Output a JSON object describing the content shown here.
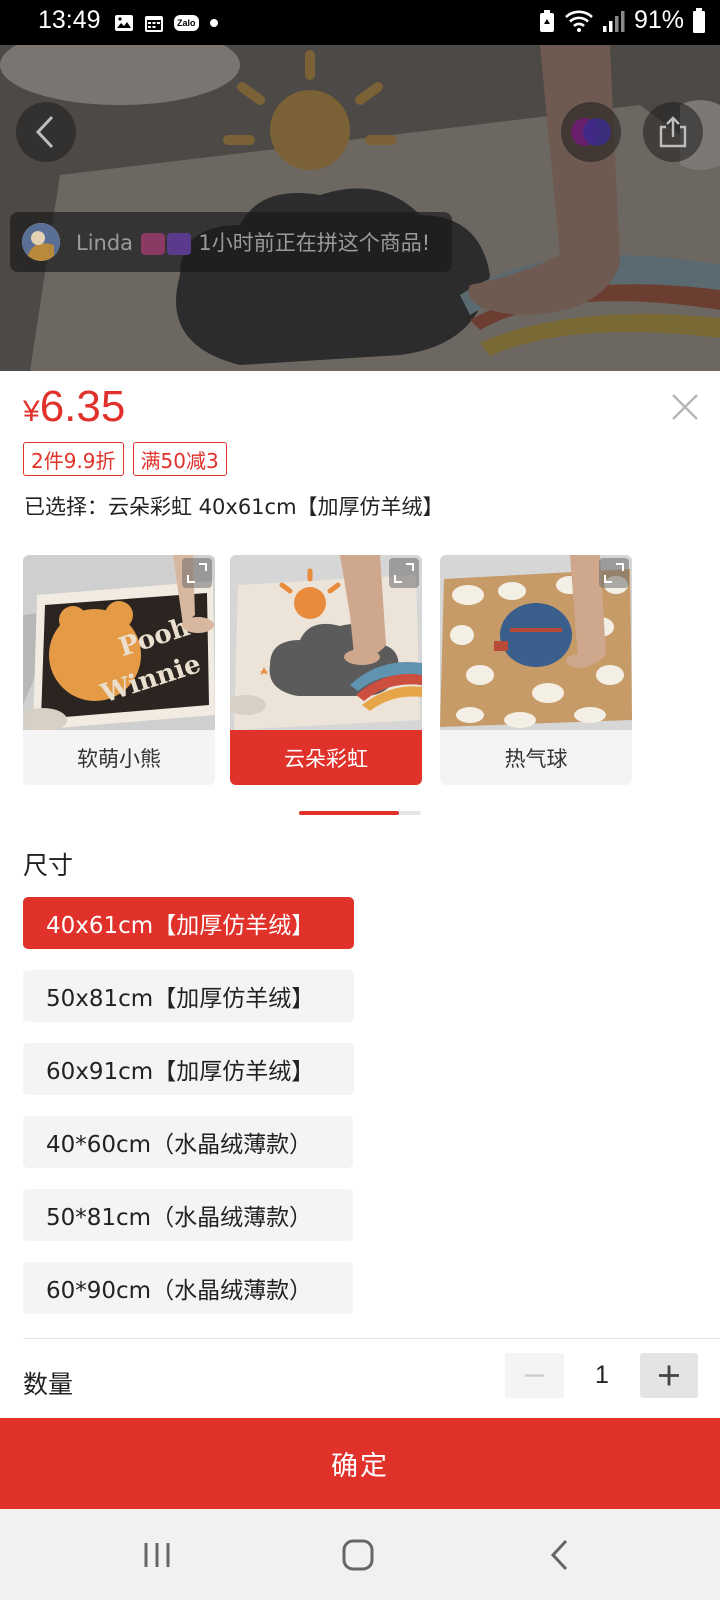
{
  "status_bar": {
    "time": "13:49",
    "battery": "91%",
    "left_icons": [
      "image-icon",
      "calendar-icon",
      "zalo-icon",
      "dot-icon"
    ],
    "zalo_text": "Zalo",
    "right_icons": [
      "recycle-icon",
      "wifi-icon",
      "signal-icon",
      "battery-icon"
    ]
  },
  "header": {
    "back_icon": "chevron-left-icon",
    "share_icon": "share-icon",
    "buyer_toast": {
      "name": "Linda",
      "suffix": "1小时前正在拼这个商品!"
    }
  },
  "product": {
    "currency": "¥",
    "price": "6.35",
    "promos": [
      "2件9.9折",
      "满50减3"
    ],
    "selected_label": "已选择：",
    "selected_value": "云朵彩虹 40x61cm【加厚仿羊绒】"
  },
  "styles": [
    {
      "label": "软萌小熊",
      "active": false
    },
    {
      "label": "云朵彩虹",
      "active": true
    },
    {
      "label": "热气球",
      "active": false
    }
  ],
  "size_section": {
    "title": "尺寸",
    "options": [
      {
        "label": "40x61cm【加厚仿羊绒】",
        "active": true
      },
      {
        "label": "50x81cm【加厚仿羊绒】",
        "active": false
      },
      {
        "label": "60x91cm【加厚仿羊绒】",
        "active": false
      },
      {
        "label": "40*60cm（水晶绒薄款）",
        "active": false
      },
      {
        "label": "50*81cm（水晶绒薄款）",
        "active": false
      },
      {
        "label": "60*90cm（水晶绒薄款）",
        "active": false
      }
    ]
  },
  "quantity": {
    "label": "数量",
    "value": "1"
  },
  "confirm_label": "确定",
  "nav_bar": {
    "recents_icon": "recents-icon",
    "home_icon": "home-icon",
    "back_icon": "back-icon"
  },
  "colors": {
    "accent": "#e0322b",
    "option_bg": "#f4f4f4"
  }
}
